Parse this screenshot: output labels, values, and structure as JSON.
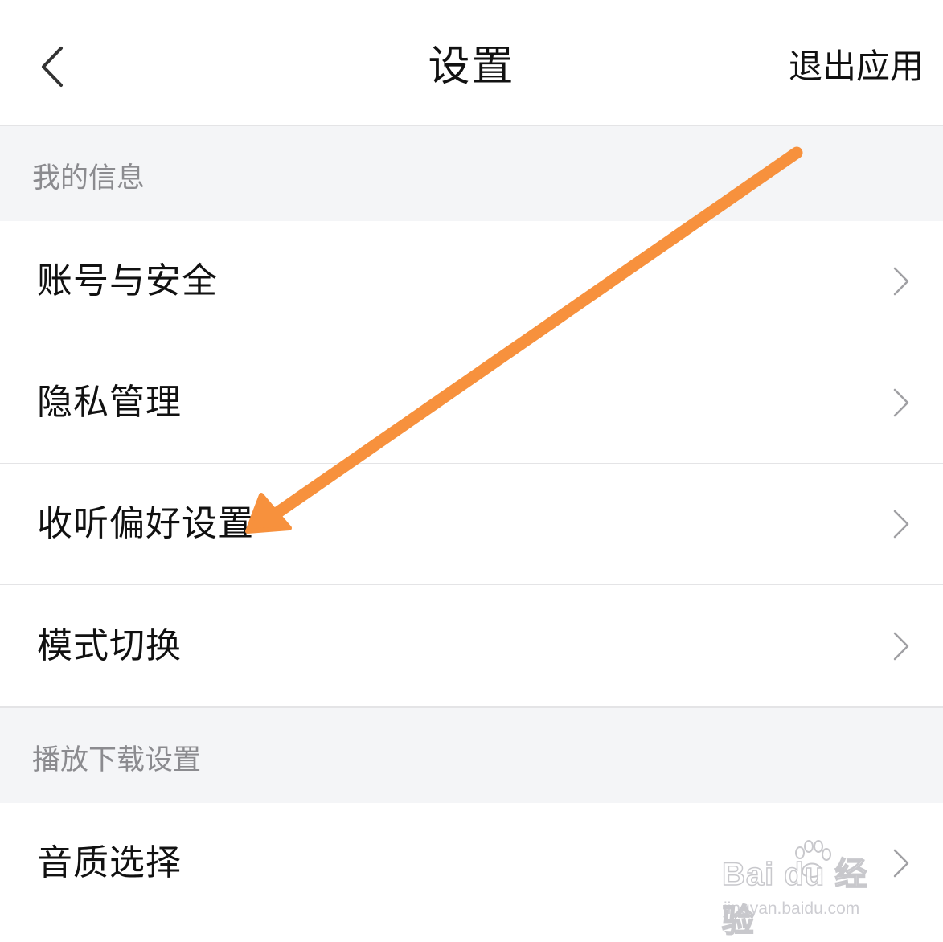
{
  "header": {
    "back_icon": "chevron-left-icon",
    "title": "设置",
    "exit_label": "退出应用"
  },
  "sections": [
    {
      "title": "我的信息",
      "items": [
        {
          "label": "账号与安全",
          "icon": "chevron-right-icon"
        },
        {
          "label": "隐私管理",
          "icon": "chevron-right-icon"
        },
        {
          "label": "收听偏好设置",
          "icon": "chevron-right-icon"
        },
        {
          "label": "模式切换",
          "icon": "chevron-right-icon"
        }
      ]
    },
    {
      "title": "播放下载设置",
      "items": [
        {
          "label": "音质选择",
          "icon": "chevron-right-icon"
        }
      ]
    }
  ],
  "annotation": {
    "type": "arrow",
    "color": "#f7913d",
    "target": "收听偏好设置"
  },
  "watermark": {
    "logo": "Bai du 经验",
    "url": "jingyan.baidu.com"
  },
  "colors": {
    "background": "#ffffff",
    "section_bg": "#f4f5f7",
    "section_text": "#8b8b8f",
    "divider": "#e4e4e6",
    "chevron": "#a0a0a4"
  }
}
